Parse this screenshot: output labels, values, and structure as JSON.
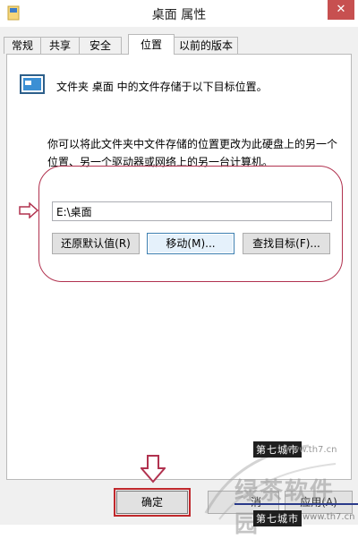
{
  "window": {
    "title": "桌面 属性",
    "close_glyph": "✕"
  },
  "tabs": [
    {
      "label": "常规"
    },
    {
      "label": "共享"
    },
    {
      "label": "安全"
    },
    {
      "label": "位置",
      "active": true
    },
    {
      "label": "以前的版本"
    }
  ],
  "location": {
    "info_text": "文件夹 桌面 中的文件存储于以下目标位置。",
    "description": "你可以将此文件夹中文件存储的位置更改为此硬盘上的另一个位置、另一个驱动器或网络上的另一台计算机。",
    "path_value": "E:\\桌面",
    "buttons": {
      "restore_default": "还原默认值(R)",
      "move": "移动(M)...",
      "find_target": "查找目标(F)..."
    }
  },
  "footer": {
    "ok": "确定",
    "cancel_partial": "消",
    "apply_partial": "应用(A)"
  },
  "watermark": {
    "site_name": "第七城市",
    "url": "www.th7.cn",
    "brand": "绿茶软件园"
  },
  "colors": {
    "annotation": "#b1324f",
    "close_button": "#c75050",
    "ok_highlight": "#c0282c"
  },
  "icons": [
    "folder-properties-icon",
    "close-icon",
    "folder-location-icon",
    "arrow-right-annotation-icon",
    "arrow-down-annotation-icon"
  ]
}
